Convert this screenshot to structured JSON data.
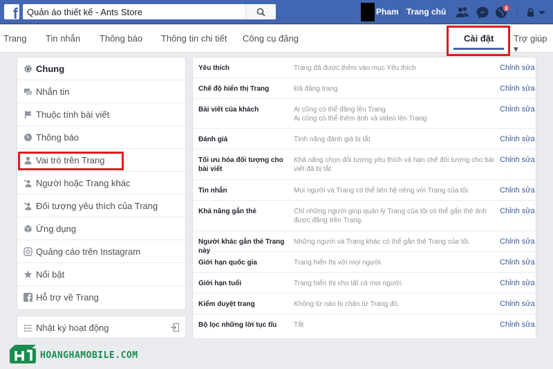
{
  "topbar": {
    "search_value": "Quản áo thiết kế - Ants Store",
    "profile_name": "Pham",
    "home_label": "Trang chủ",
    "notification_count": "8",
    "colors": {
      "bar": "#4267b2",
      "badge": "#fa3e3e"
    }
  },
  "page_nav": {
    "items": [
      "Trang",
      "Tin nhắn",
      "Thông báo",
      "Thông tin chi tiết",
      "Công cụ đăng"
    ],
    "settings": "Cài đặt",
    "help": "Trợ giúp ▾"
  },
  "sidebar": {
    "items": [
      {
        "label": "Chung",
        "icon": "gear-icon"
      },
      {
        "label": "Nhắn tin",
        "icon": "chat-bubble-icon"
      },
      {
        "label": "Thuộc tính bài viết",
        "icon": "flag-icon"
      },
      {
        "label": "Thông báo",
        "icon": "globe-icon"
      },
      {
        "label": "Vai trò trên Trang",
        "icon": "person-icon"
      },
      {
        "label": "Người hoặc Trang khác",
        "icon": "person-add-icon"
      },
      {
        "label": "Đối tượng yêu thích của Trang",
        "icon": "person-add-icon"
      },
      {
        "label": "Ứng dụng",
        "icon": "cube-icon"
      },
      {
        "label": "Quảng cáo trên Instagram",
        "icon": "instagram-icon"
      },
      {
        "label": "Nổi bật",
        "icon": "star-icon"
      },
      {
        "label": "Hỗ trợ về Trang",
        "icon": "facebook-icon"
      }
    ],
    "activity_log": "Nhật ký hoạt động"
  },
  "settings": {
    "edit_label": "Chỉnh sửa",
    "rows": [
      {
        "name": "Yêu thích",
        "value": "Trang đã được thêm vào mục Yêu thích"
      },
      {
        "name": "Chế độ hiển thị Trang",
        "value": "Đã đăng trang"
      },
      {
        "name": "Bài viết của khách",
        "value": "Ai cũng có thể đăng lên Trang",
        "value2": "Ai cũng có thể thêm ảnh và video lên Trang"
      },
      {
        "name": "Đánh giá",
        "value": "Tính năng đánh giá bị tắt"
      },
      {
        "name": "Tối ưu hóa đối tượng cho bài viết",
        "value": "Khả năng chọn đối tượng yêu thích và hạn chế đối tượng cho bài viết đã bị tắt"
      },
      {
        "name": "Tin nhắn",
        "value": "Mọi người và Trang có thể liên hệ riêng với Trang của tôi."
      },
      {
        "name": "Khả năng gắn thẻ",
        "value": "Chỉ những người giúp quản lý Trang của tôi có thể gắn thẻ ảnh được đăng trên Trang."
      },
      {
        "name": "Người khác gắn thẻ Trang này",
        "value": "Những người và Trang khác có thể gắn thẻ Trang của tôi."
      },
      {
        "name": "Giới hạn quốc gia",
        "value": "Trang hiển thị với mọi người."
      },
      {
        "name": "Giới hạn tuổi",
        "value": "Trang hiển thị cho tất cả mọi người."
      },
      {
        "name": "Kiểm duyệt trang",
        "value": "Không từ nào bị chặn từ Trang đó."
      },
      {
        "name": "Bộ lọc những lời tục tĩu",
        "value": "Tắt"
      }
    ]
  },
  "watermark": {
    "text": "HOANGHAMOBILE.COM"
  }
}
